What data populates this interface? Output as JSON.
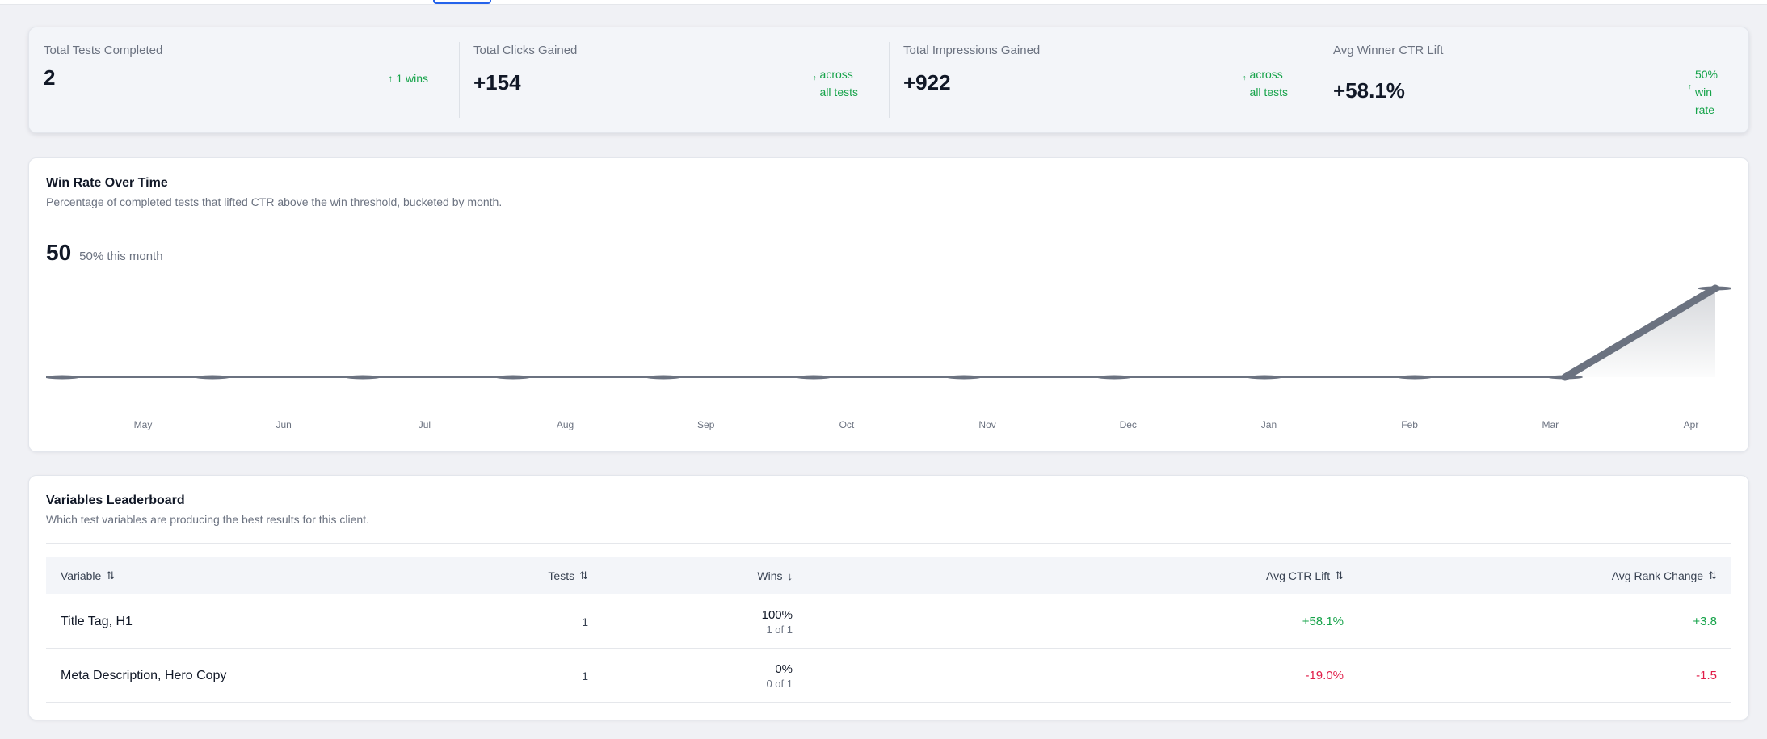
{
  "stats": [
    {
      "label": "Total Tests Completed",
      "value": "2",
      "trend": "1 wins"
    },
    {
      "label": "Total Clicks Gained",
      "value": "+154",
      "trend": "across\nall tests"
    },
    {
      "label": "Total Impressions Gained",
      "value": "+922",
      "trend": "across\nall tests"
    },
    {
      "label": "Avg Winner CTR Lift",
      "value": "+58.1%",
      "trend": "50%\nwin\nrate"
    }
  ],
  "trend_arrow_symbol": "↑",
  "chart_card": {
    "title": "Win Rate Over Time",
    "subtitle": "Percentage of completed tests that lifted CTR above the win threshold, bucketed by month.",
    "headline_value": "50",
    "headline_note": "50% this month"
  },
  "chart_data": {
    "type": "area",
    "x": [
      "May",
      "Jun",
      "Jul",
      "Aug",
      "Sep",
      "Oct",
      "Nov",
      "Dec",
      "Jan",
      "Feb",
      "Mar",
      "Apr"
    ],
    "values": [
      0,
      0,
      0,
      0,
      0,
      0,
      0,
      0,
      0,
      0,
      0,
      50
    ],
    "ylim": [
      0,
      50
    ],
    "grid": false,
    "legend": "none",
    "line_color": "#6b7280"
  },
  "leaderboard": {
    "title": "Variables Leaderboard",
    "subtitle": "Which test variables are producing the best results for this client.",
    "columns": {
      "variable": "Variable",
      "tests": "Tests",
      "wins": "Wins",
      "ctr": "Avg CTR Lift",
      "rank": "Avg Rank Change"
    },
    "sort_icon": "⇅",
    "sort_desc_icon": "↓",
    "rows": [
      {
        "variable": "Title Tag, H1",
        "tests": "1",
        "wins_pct": "100%",
        "wins_ratio": "1 of 1",
        "ctr": "+58.1%",
        "rank": "+3.8",
        "ctr_sign": "pos",
        "rank_sign": "pos"
      },
      {
        "variable": "Meta Description, Hero Copy",
        "tests": "1",
        "wins_pct": "0%",
        "wins_ratio": "0 of 1",
        "ctr": "-19.0%",
        "rank": "-1.5",
        "ctr_sign": "neg",
        "rank_sign": "neg"
      }
    ]
  },
  "colors": {
    "positive": "#16a34a",
    "negative": "#e11d48",
    "accent": "#2563eb"
  }
}
